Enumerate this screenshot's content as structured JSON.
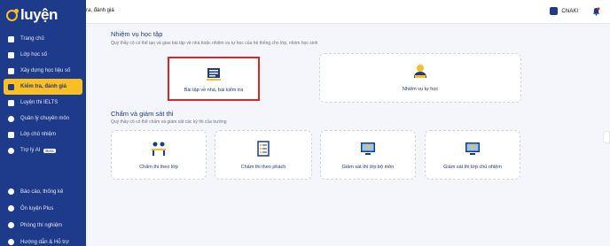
{
  "app": {
    "logo": "luyện"
  },
  "sidebar": {
    "items": [
      {
        "label": "Trang chủ"
      },
      {
        "label": "Lớp học số"
      },
      {
        "label": "Xây dựng học liệu số"
      },
      {
        "label": "Kiểm tra, đánh giá"
      },
      {
        "label": "Luyện thi IELTS"
      },
      {
        "label": "Quản lý chuyên môn"
      },
      {
        "label": "Lớp chủ nhiệm"
      },
      {
        "label": "Trợ lý AI",
        "badge": "Beta"
      }
    ],
    "bottom_items": [
      {
        "label": "Báo cáo, thống kê"
      },
      {
        "label": "Ôn luyện Plus"
      },
      {
        "label": "Phòng thí nghiệm"
      },
      {
        "label": "Hướng dẫn & Hỗ trợ"
      }
    ]
  },
  "header": {
    "breadcrumb": "ra, đánh giá",
    "user": "ChiAKI"
  },
  "tasks": {
    "title": "Nhiệm vụ học tập",
    "subtitle": "Quý thầy cô có thể tạo và giao bài tập về nhà hoặc nhiệm vụ tự học của hệ thống cho lớp, nhóm học sinh",
    "cards": [
      {
        "label": "Bài tập về nhà, bài kiểm tra"
      },
      {
        "label": "Nhiệm vụ tự học"
      }
    ]
  },
  "grading": {
    "title": "Chấm và giám sát thi",
    "subtitle": "Quý thầy cô có thể chấm và giám sát các kỳ thi của trường",
    "cards": [
      {
        "label": "Chấm thi theo lớp"
      },
      {
        "label": "Chấm thi theo phách"
      },
      {
        "label": "Giám sát thi lớp bộ môn"
      },
      {
        "label": "Giám sát thi lớp chủ nhiệm"
      }
    ]
  }
}
